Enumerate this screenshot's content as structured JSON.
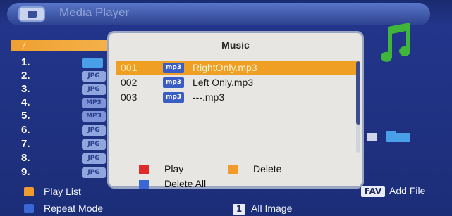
{
  "window": {
    "title": "Media Player"
  },
  "browser": {
    "path": "/",
    "rows": [
      {
        "num": "1.",
        "type": ""
      },
      {
        "num": "2.",
        "type": "JPG"
      },
      {
        "num": "3.",
        "type": "JPG"
      },
      {
        "num": "4.",
        "type": "MP3"
      },
      {
        "num": "5.",
        "type": "MP3"
      },
      {
        "num": "6.",
        "type": "JPG"
      },
      {
        "num": "7.",
        "type": "JPG"
      },
      {
        "num": "8.",
        "type": "JPG"
      },
      {
        "num": "9.",
        "type": "JPG"
      }
    ]
  },
  "bottom_bar": {
    "play_list": "Play List",
    "repeat_mode": "Repeat Mode",
    "fav_key": "FAV",
    "add_file": "Add File",
    "num_key": "1",
    "all_image": "All Image"
  },
  "dialog": {
    "title": "Music",
    "tracks": [
      {
        "num": "001",
        "badge": "mp3",
        "name": "RightOnly.mp3",
        "selected": true
      },
      {
        "num": "002",
        "badge": "mp3",
        "name": "Left Only.mp3",
        "selected": false
      },
      {
        "num": "003",
        "badge": "mp3",
        "name": "---.mp3",
        "selected": false
      }
    ],
    "actions": {
      "play": "Play",
      "delete": "Delete",
      "delete_all": "Delete All"
    }
  },
  "colors": {
    "selected_row": "#ef9f24",
    "red_key": "#e02a2a",
    "orange_key": "#f39a2c",
    "blue_key": "#3a66d6"
  }
}
